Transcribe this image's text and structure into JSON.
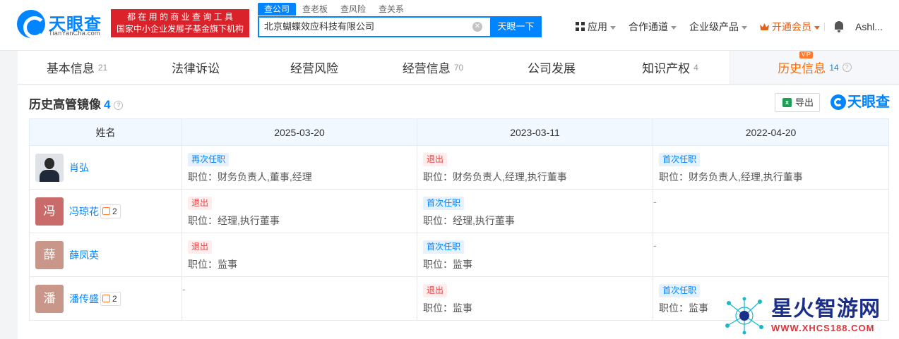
{
  "header": {
    "logo_cn": "天眼查",
    "logo_en": "TianYanCha.com",
    "slogan_line1": "都 在 用 的 商 业 查 询 工 具",
    "slogan_line2": "国家中小企业发展子基金旗下机构",
    "search_tabs": [
      "查公司",
      "查老板",
      "查风险",
      "查关系"
    ],
    "search_value": "北京蝴蝶效应科技有限公司",
    "search_button": "天眼一下",
    "nav": {
      "apps": "应用",
      "partners": "合作通道",
      "enterprise": "企业级产品",
      "vip": "开通会员",
      "user": "Ashl..."
    }
  },
  "tabs": [
    {
      "label": "基本信息",
      "count": "21"
    },
    {
      "label": "法律诉讼",
      "count": ""
    },
    {
      "label": "经营风险",
      "count": ""
    },
    {
      "label": "经营信息",
      "count": "70"
    },
    {
      "label": "公司发展",
      "count": ""
    },
    {
      "label": "知识产权",
      "count": "4"
    },
    {
      "label": "历史信息",
      "count": "14",
      "tag": "VIP"
    }
  ],
  "section": {
    "title": "历史高管镜像",
    "count": "4",
    "export_label": "导出",
    "brand": "天眼查"
  },
  "table": {
    "headers": [
      "姓名",
      "2025-03-20",
      "2023-03-11",
      "2022-04-20"
    ],
    "rows": [
      {
        "name": "肖弘",
        "avatar_char": "",
        "avatar_color": "#dfe3e8",
        "relations": "",
        "cells": [
          {
            "status": "再次任职",
            "status_type": "blue",
            "position": "职位：财务负责人,董事,经理"
          },
          {
            "status": "退出",
            "status_type": "red",
            "position": "职位：财务负责人,经理,执行董事"
          },
          {
            "status": "首次任职",
            "status_type": "blue",
            "position": "职位：财务负责人,经理,执行董事"
          }
        ]
      },
      {
        "name": "冯琼花",
        "avatar_char": "冯",
        "avatar_color": "#c96b6b",
        "relations": "2",
        "cells": [
          {
            "status": "退出",
            "status_type": "red",
            "position": "职位：经理,执行董事"
          },
          {
            "status": "首次任职",
            "status_type": "blue",
            "position": "职位：经理,执行董事"
          },
          {
            "dash": "-"
          }
        ]
      },
      {
        "name": "薛凤英",
        "avatar_char": "薛",
        "avatar_color": "#c9978a",
        "relations": "",
        "cells": [
          {
            "status": "退出",
            "status_type": "red",
            "position": "职位：监事"
          },
          {
            "status": "首次任职",
            "status_type": "blue",
            "position": "职位：监事"
          },
          {
            "dash": "-"
          }
        ]
      },
      {
        "name": "潘传盛",
        "avatar_char": "潘",
        "avatar_color": "#c9978a",
        "relations": "2",
        "cells": [
          {
            "dash": "-"
          },
          {
            "status": "退出",
            "status_type": "red",
            "position": "职位：监事"
          },
          {
            "status": "首次任职",
            "status_type": "blue",
            "position": "职位：监事"
          }
        ]
      }
    ]
  },
  "watermark": {
    "text": "星火智游网",
    "url": "WWW.XHCS188.COM"
  }
}
